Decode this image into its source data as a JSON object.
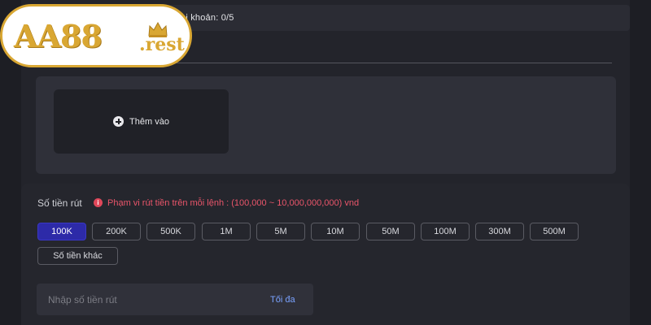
{
  "logo": {
    "main": "AA88",
    "suffix": ".rest"
  },
  "header": {
    "account_count": "ài khoản:  0/5"
  },
  "bank": {
    "add_label": "Thêm vào"
  },
  "withdraw": {
    "amount_label": "Số tiền rút",
    "limit_text": "Phạm vi rút tiền trên mỗi lệnh : (100,000 ~ 10,000,000,000) vnd",
    "chips": [
      "100K",
      "200K",
      "500K",
      "1M",
      "5M",
      "10M",
      "50M",
      "100M",
      "300M",
      "500M"
    ],
    "selected_chip": "100K",
    "other_amount": "Số tiền khác",
    "input_placeholder": "Nhập số tiền rút",
    "input_value": "",
    "max_label": "Tối đa"
  },
  "colors": {
    "accent": "#2d2aa8",
    "warning": "#e9556a",
    "link": "#7aa2ff",
    "logo_gold": "#d9a733"
  }
}
